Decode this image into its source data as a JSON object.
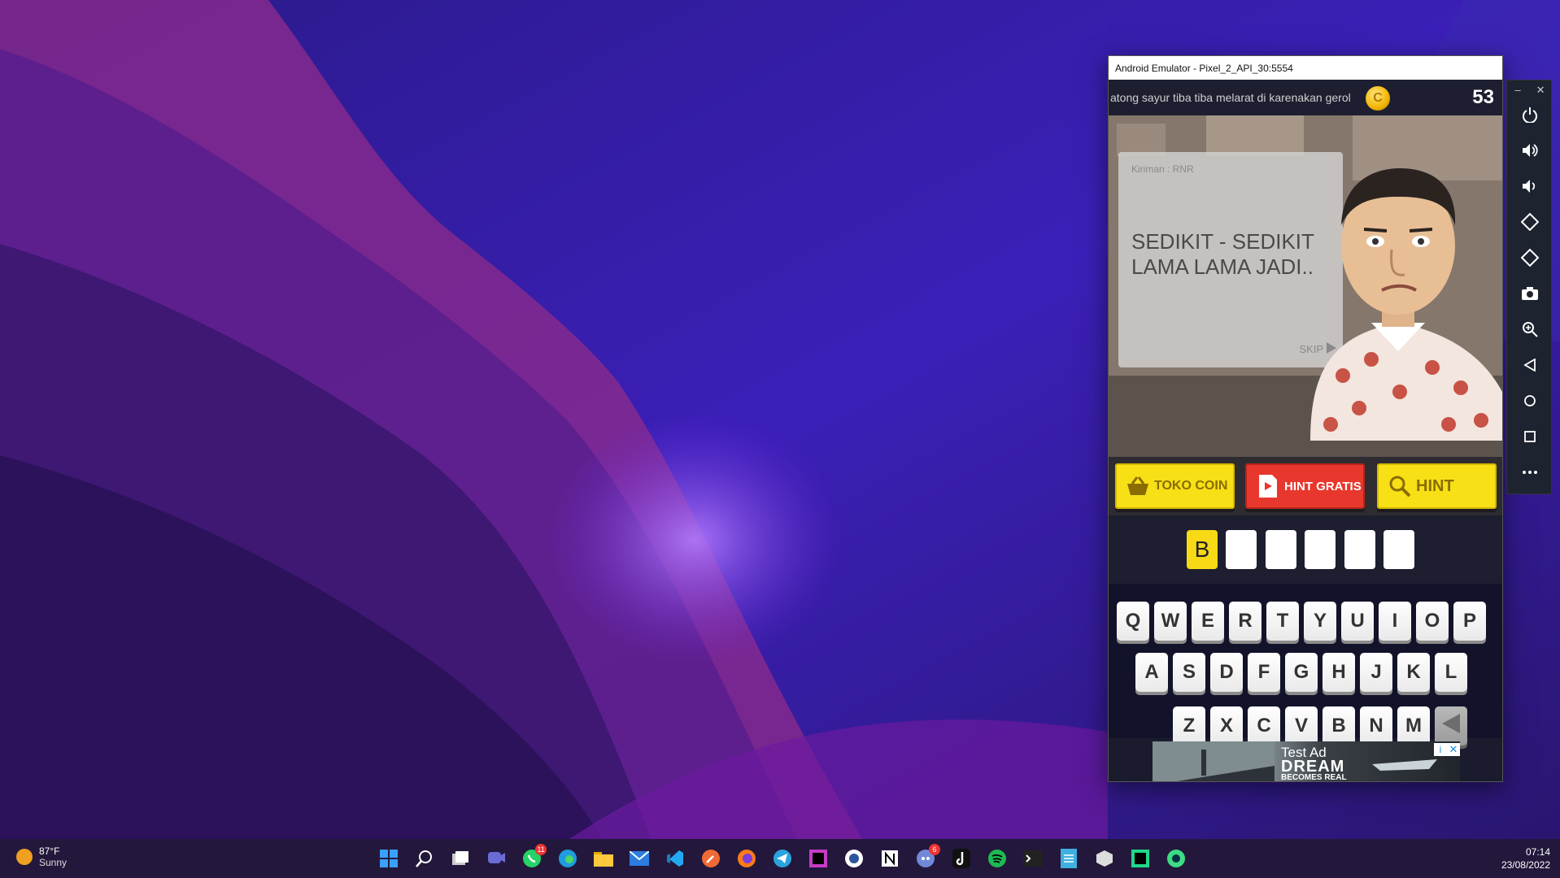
{
  "emulator": {
    "title": "Android Emulator - Pixel_2_API_30:5554"
  },
  "game": {
    "marquee": "atong sayur tiba tiba melarat di karenakan gerol",
    "coin_symbol": "C",
    "coins": "53",
    "sender": "Kiriman : RNR",
    "question": "SEDIKIT - SEDIKIT LAMA LAMA JADI..",
    "skip_label": "SKIP",
    "buttons": {
      "toko_coin": "TOKO COIN",
      "hint_gratis": "HINT GRATIS",
      "hint": "HINT"
    },
    "answer_slots": [
      "B",
      "",
      "",
      "",
      "",
      ""
    ],
    "keyboard": {
      "row1": [
        "Q",
        "W",
        "E",
        "R",
        "T",
        "Y",
        "U",
        "I",
        "O",
        "P"
      ],
      "row2": [
        "A",
        "S",
        "D",
        "F",
        "G",
        "H",
        "J",
        "K",
        "L"
      ],
      "row3": [
        "Z",
        "X",
        "C",
        "V",
        "B",
        "N",
        "M"
      ]
    },
    "ad": {
      "label": "Test Ad",
      "headline": "DREAM",
      "subline": "BECOMES REAL",
      "info_icon": "i",
      "close_icon": "✕"
    }
  },
  "emulator_toolbar": {
    "minimize": "–",
    "close": "✕",
    "tools": [
      "power-icon",
      "volume-up-icon",
      "volume-down-icon",
      "rotate-left-icon",
      "rotate-right-icon",
      "camera-icon",
      "zoom-icon",
      "back-icon",
      "home-icon",
      "overview-icon",
      "more-icon"
    ]
  },
  "taskbar": {
    "weather_temp": "87°F",
    "weather_desc": "Sunny",
    "whatsapp_badge": "11",
    "discord_badge": "6",
    "time": "07:14",
    "date": "23/08/2022"
  },
  "colors": {
    "accent_yellow": "#f7e016",
    "hint_red": "#e8372c",
    "taskbar_bg": "#23183c"
  }
}
